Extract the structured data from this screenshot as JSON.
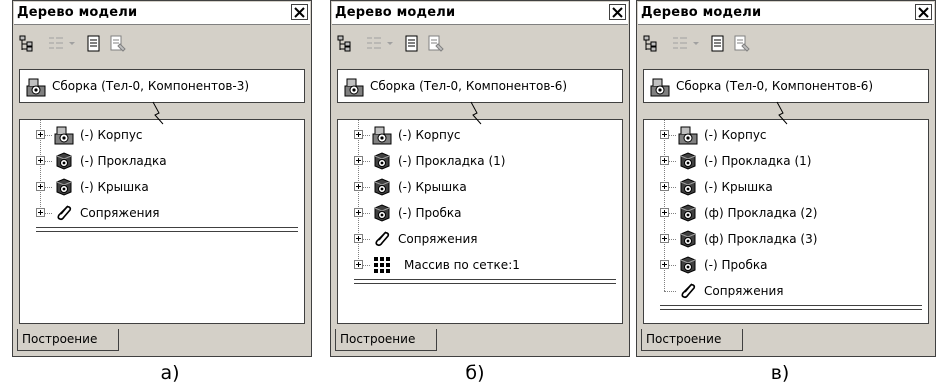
{
  "panels": [
    {
      "title": "Дерево модели",
      "root_label": "Сборка (Тел-0, Компонентов-3)",
      "tab_label": "Построение",
      "caption": "а)",
      "items": [
        {
          "label": "(-) Корпус",
          "icon": "assembly-part-icon",
          "expandable": true
        },
        {
          "label": "(-) Прокладка",
          "icon": "part-icon",
          "expandable": true
        },
        {
          "label": "(-) Крышка",
          "icon": "part-icon",
          "expandable": true
        },
        {
          "label": "Сопряжения",
          "icon": "paperclip-icon",
          "expandable": true
        }
      ]
    },
    {
      "title": "Дерево модели",
      "root_label": "Сборка (Тел-0, Компонентов-6)",
      "tab_label": "Построение",
      "caption": "б)",
      "items": [
        {
          "label": "(-) Корпус",
          "icon": "assembly-part-icon",
          "expandable": true
        },
        {
          "label": "(-) Прокладка (1)",
          "icon": "part-icon",
          "expandable": true
        },
        {
          "label": "(-) Крышка",
          "icon": "part-icon",
          "expandable": true
        },
        {
          "label": "(-) Пробка",
          "icon": "part-icon",
          "expandable": true
        },
        {
          "label": "Сопряжения",
          "icon": "paperclip-icon",
          "expandable": true
        },
        {
          "label": "Массив по сетке:1",
          "icon": "grid-array-icon",
          "expandable": true
        }
      ]
    },
    {
      "title": "Дерево модели",
      "root_label": "Сборка (Тел-0, Компонентов-6)",
      "tab_label": "Построение",
      "caption": "в)",
      "items": [
        {
          "label": "(-) Корпус",
          "icon": "assembly-part-icon",
          "expandable": true
        },
        {
          "label": "(-) Прокладка (1)",
          "icon": "part-icon",
          "expandable": true
        },
        {
          "label": "(-) Крышка",
          "icon": "part-icon",
          "expandable": true
        },
        {
          "label": "(ф) Прокладка (2)",
          "icon": "part-icon",
          "expandable": true
        },
        {
          "label": "(ф) Прокладка (3)",
          "icon": "part-icon",
          "expandable": true
        },
        {
          "label": "(-) Пробка",
          "icon": "part-icon",
          "expandable": true
        },
        {
          "label": "Сопряжения",
          "icon": "paperclip-icon",
          "expandable": false
        }
      ]
    }
  ]
}
